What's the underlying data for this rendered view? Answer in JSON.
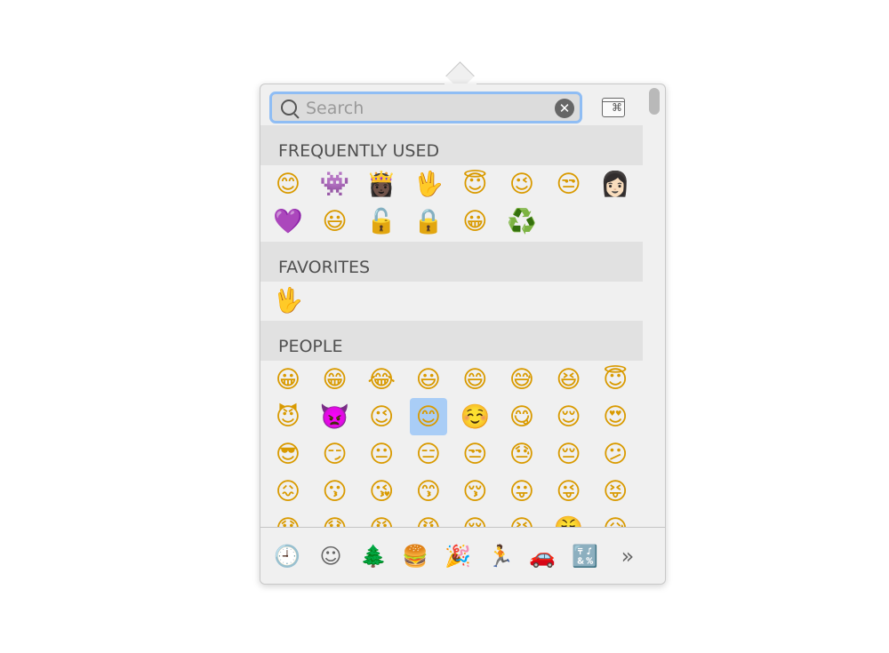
{
  "search": {
    "placeholder": "Search",
    "value": "",
    "clear_icon": "✕"
  },
  "viewer_button": {
    "icon": "⌘"
  },
  "sections": [
    {
      "title": "FREQUENTLY USED",
      "emojis": [
        "😊",
        "👾",
        "👸🏿",
        "🖖",
        "😇",
        "😉",
        "😒",
        "👩🏻",
        "💜",
        "😃",
        "🔓",
        "🔒",
        "😀",
        "♻️"
      ]
    },
    {
      "title": "FAVORITES",
      "emojis": [
        "🖖"
      ]
    },
    {
      "title": "PEOPLE",
      "emojis": [
        "😀",
        "😁",
        "😂",
        "😃",
        "😄",
        "😅",
        "😆",
        "😇",
        "😈",
        "👿",
        "😉",
        "😊",
        "☺️",
        "😋",
        "😌",
        "😍",
        "😎",
        "😏",
        "😐",
        "😑",
        "😒",
        "😓",
        "😔",
        "😕",
        "😖",
        "😗",
        "😘",
        "😙",
        "😚",
        "😛",
        "😜",
        "😝",
        "😞",
        "😟",
        "😠",
        "😡",
        "😢",
        "😣",
        "😤",
        "😥"
      ]
    }
  ],
  "selected_emoji": {
    "section": "PEOPLE",
    "index": 11
  },
  "category_tabs": [
    {
      "name": "frequently-used",
      "icon": "🕘",
      "active": true
    },
    {
      "name": "smileys-people",
      "icon": "☺"
    },
    {
      "name": "animals-nature",
      "icon": "🌲"
    },
    {
      "name": "food-drink",
      "icon": "🍔"
    },
    {
      "name": "celebration",
      "icon": "🎉"
    },
    {
      "name": "activity",
      "icon": "🏃"
    },
    {
      "name": "travel-places",
      "icon": "🚗"
    },
    {
      "name": "symbols",
      "icon": "🔣"
    },
    {
      "name": "more",
      "icon": "»"
    }
  ],
  "colors": {
    "accent": "#2f86e8",
    "search_focus": "#8fbdf4",
    "selection": "#a9cdf6"
  }
}
